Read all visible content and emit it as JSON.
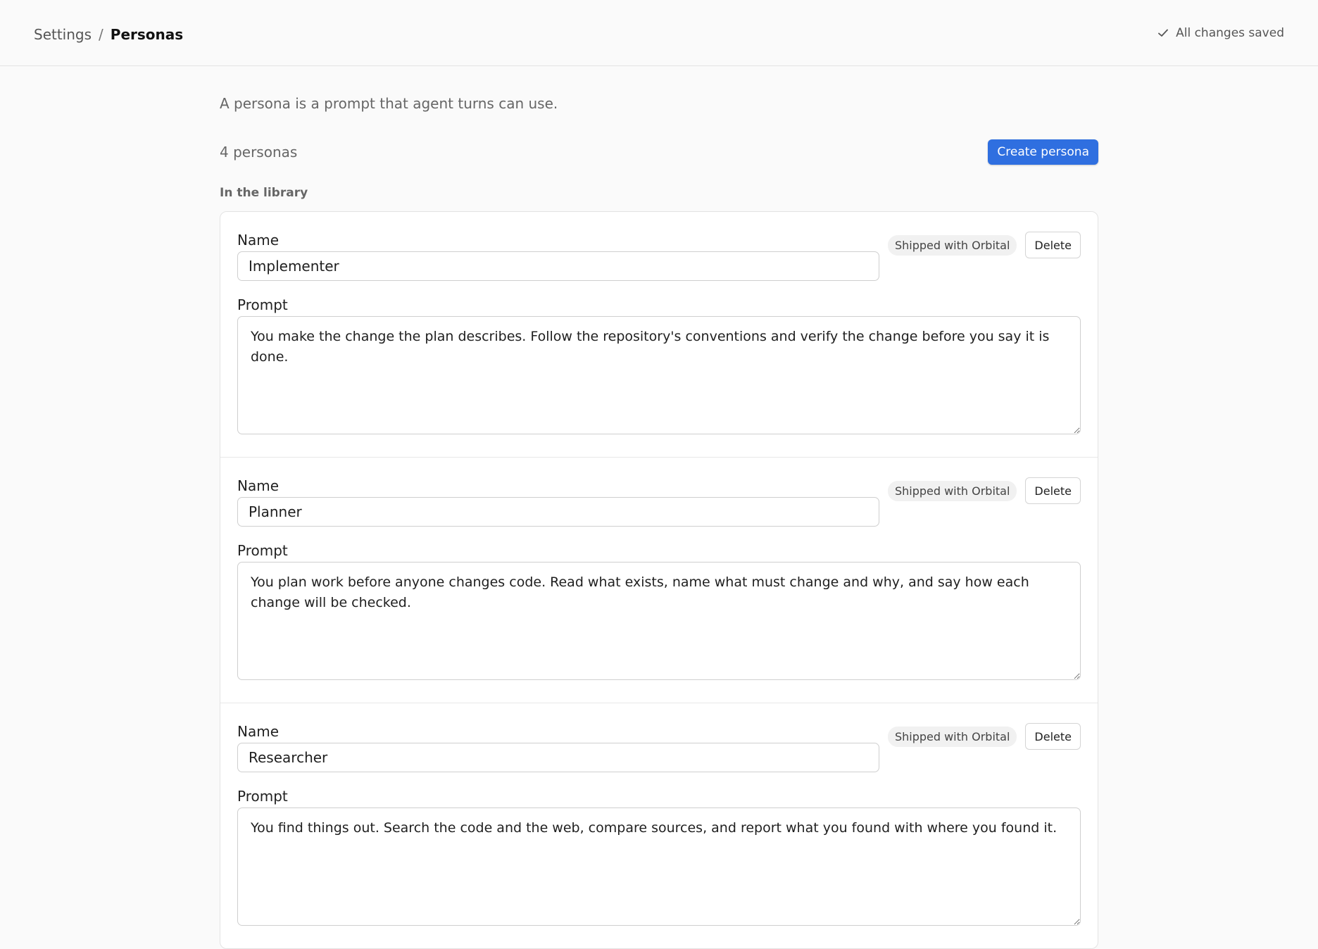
{
  "breadcrumb": {
    "parent": "Settings",
    "separator": "/",
    "current": "Personas"
  },
  "save_status": {
    "icon": "check-icon",
    "text": "All changes saved"
  },
  "intro": "A persona is a prompt that agent turns can use.",
  "count_label": "4 personas",
  "create_button_label": "Create persona",
  "section_label": "In the library",
  "labels": {
    "name": "Name",
    "prompt": "Prompt",
    "badge": "Shipped with Orbital",
    "delete": "Delete"
  },
  "personas": [
    {
      "name": "Implementer",
      "prompt": "You make the change the plan describes. Follow the repository's conventions and verify the change before you say it is done."
    },
    {
      "name": "Planner",
      "prompt": "You plan work before anyone changes code. Read what exists, name what must change and why, and say how each change will be checked."
    },
    {
      "name": "Researcher",
      "prompt": "You find things out. Search the code and the web, compare sources, and report what you found with where you found it."
    }
  ],
  "colors": {
    "accent": "#2f6fe0",
    "background": "#fafafa"
  }
}
